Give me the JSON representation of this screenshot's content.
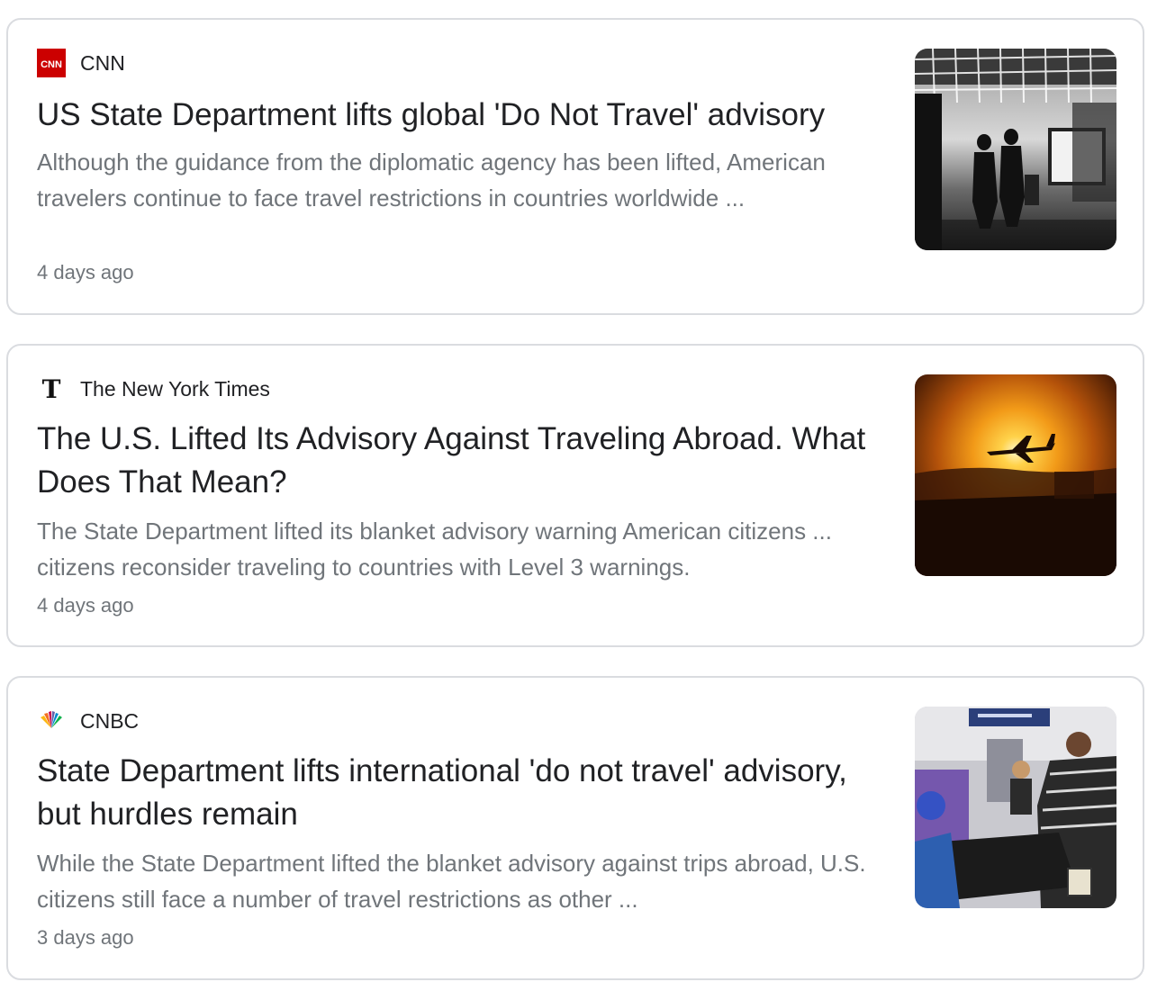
{
  "articles": [
    {
      "source": "CNN",
      "title": "US State Department lifts global 'Do Not Travel' advisory",
      "snippet": "Although the guidance from the diplomatic agency has been lifted, American travelers continue to face travel restrictions in countries worldwide ...",
      "age": "4 days ago",
      "logo": "cnn-logo",
      "logo_color": "#cc0000",
      "thumbnail": "airport-silhouette-photo"
    },
    {
      "source": "The New York Times",
      "title": "The U.S. Lifted Its Advisory Against Traveling Abroad. What Does That Mean?",
      "snippet": "The State Department lifted its blanket advisory warning American citizens ... citizens reconsider traveling to countries with Level 3 warnings.",
      "age": "4 days ago",
      "logo": "nyt-logo",
      "thumbnail": "airplane-sunset-photo"
    },
    {
      "source": "CNBC",
      "title": "State Department lifts international 'do not travel' advisory, but hurdles remain",
      "snippet": "While the State Department lifted the blanket advisory against trips abroad, U.S. citizens still face a number of travel restrictions as other ...",
      "age": "3 days ago",
      "logo": "nbc-peacock-logo",
      "thumbnail": "airport-security-photo"
    }
  ],
  "colors": {
    "title": "#202124",
    "secondary_text": "#70757a",
    "card_border": "#dadce0"
  }
}
